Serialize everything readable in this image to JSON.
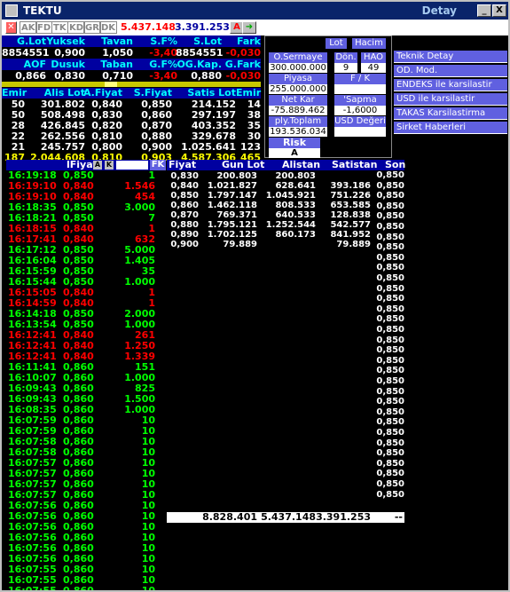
{
  "window": {
    "title": "TEKTU",
    "right_title": "Detay",
    "min": "_",
    "max": "□",
    "close": "X"
  },
  "toolbar": {
    "tabs": [
      "AK",
      "FD",
      "TK",
      "KD",
      "GR",
      "DK"
    ],
    "price": "5.437.148",
    "value": "3.391.253",
    "a_label": "A"
  },
  "quote": {
    "labels1": [
      "G.Lot",
      "Yuksek",
      "Tavan",
      "S.F%",
      "S.Lot",
      "Fark"
    ],
    "values1": [
      "8854551",
      "0,900",
      "1,050",
      "-3,40",
      "8854551",
      "-0,030"
    ],
    "labels2": [
      "AOF",
      "Dusuk",
      "Taban",
      "G.F%",
      "OG.Kap.",
      "G.Fark"
    ],
    "values2": [
      "0,866",
      "0,830",
      "0,710",
      "-3,40",
      "0,880",
      "-0,030"
    ]
  },
  "depth": {
    "headers": [
      "Emir",
      "Alis Lot",
      "A.Fiyat",
      "S.Fiyat",
      "Satis Lot",
      "Emir"
    ],
    "rows": [
      [
        "50",
        "301.802",
        "0,840",
        "0,850",
        "214.152",
        "14"
      ],
      [
        "50",
        "508.498",
        "0,830",
        "0,860",
        "297.197",
        "38"
      ],
      [
        "28",
        "426.845",
        "0,820",
        "0,870",
        "403.352",
        "35"
      ],
      [
        "22",
        "262.556",
        "0,810",
        "0,880",
        "329.678",
        "30"
      ],
      [
        "21",
        "245.757",
        "0,800",
        "0,900",
        "1.025.641",
        "123"
      ]
    ],
    "total": [
      "187",
      "2.044.608",
      "0,810",
      "0,903",
      "4.587.306",
      "465"
    ]
  },
  "panel": {
    "lot": "Lot",
    "hacim": "Hacim",
    "osermaye_label": "O.Sermaye",
    "osermaye": "300.000.000",
    "don_label": "Dön.",
    "don": "9",
    "hao_label": "HAO",
    "hao": "49",
    "piyasa_label": "Piyasa Değeri",
    "piyasa": "255.000.000",
    "fk_label": "F / K",
    "fk": "",
    "netkar_label": "Net Kar",
    "netkar": "-75.889.462",
    "sapma_label": "'Sapma",
    "sapma": "-1,6000",
    "toplam_label": "ply.Toplam Lot",
    "toplam": "193.536.034",
    "usd_label": "USD Değeri",
    "usd": "",
    "risk_label": "Risk Kodu",
    "risk": "A"
  },
  "menu": [
    "Teknik Detay",
    "OD. Mod.",
    "ENDEKS ile karsilastir",
    "USD ile karsilastir",
    "TAKAS Karsilastirma",
    "Sirket Haberleri"
  ],
  "trades": {
    "headers": [
      "lFiyat",
      "A",
      "K",
      "FK"
    ],
    "rows": [
      [
        "16:19:18",
        "0,850",
        "1",
        "g"
      ],
      [
        "16:19:10",
        "0,840",
        "1.546",
        "r"
      ],
      [
        "16:19:10",
        "0,840",
        "454",
        "r"
      ],
      [
        "16:18:35",
        "0,850",
        "3.000",
        "g"
      ],
      [
        "16:18:21",
        "0,850",
        "7",
        "g"
      ],
      [
        "16:18:15",
        "0,840",
        "1",
        "r"
      ],
      [
        "16:17:41",
        "0,840",
        "632",
        "r"
      ],
      [
        "16:17:12",
        "0,850",
        "5.000",
        "g"
      ],
      [
        "16:16:04",
        "0,850",
        "1.405",
        "g"
      ],
      [
        "16:15:59",
        "0,850",
        "35",
        "g"
      ],
      [
        "16:15:44",
        "0,850",
        "1.000",
        "g"
      ],
      [
        "16:15:05",
        "0,840",
        "1",
        "r"
      ],
      [
        "16:14:59",
        "0,840",
        "1",
        "r"
      ],
      [
        "16:14:18",
        "0,850",
        "2.000",
        "g"
      ],
      [
        "16:13:54",
        "0,850",
        "1.000",
        "g"
      ],
      [
        "16:12:41",
        "0,840",
        "261",
        "r"
      ],
      [
        "16:12:41",
        "0,840",
        "1.250",
        "r"
      ],
      [
        "16:12:41",
        "0,840",
        "1.339",
        "r"
      ],
      [
        "16:11:41",
        "0,860",
        "151",
        "g"
      ],
      [
        "16:10:07",
        "0,860",
        "1.000",
        "g"
      ],
      [
        "16:09:43",
        "0,860",
        "825",
        "g"
      ],
      [
        "16:09:43",
        "0,860",
        "1.500",
        "g"
      ],
      [
        "16:08:35",
        "0,860",
        "1.000",
        "g"
      ],
      [
        "16:07:59",
        "0,860",
        "10",
        "g"
      ],
      [
        "16:07:59",
        "0,860",
        "10",
        "g"
      ],
      [
        "16:07:58",
        "0,860",
        "10",
        "g"
      ],
      [
        "16:07:58",
        "0,860",
        "10",
        "g"
      ],
      [
        "16:07:57",
        "0,860",
        "10",
        "g"
      ],
      [
        "16:07:57",
        "0,860",
        "10",
        "g"
      ],
      [
        "16:07:57",
        "0,860",
        "10",
        "g"
      ],
      [
        "16:07:57",
        "0,860",
        "10",
        "g"
      ],
      [
        "16:07:56",
        "0,860",
        "10",
        "g"
      ],
      [
        "16:07:56",
        "0,860",
        "10",
        "g"
      ],
      [
        "16:07:56",
        "0,860",
        "10",
        "g"
      ],
      [
        "16:07:56",
        "0,860",
        "10",
        "g"
      ],
      [
        "16:07:56",
        "0,860",
        "10",
        "g"
      ],
      [
        "16:07:56",
        "0,860",
        "10",
        "g"
      ],
      [
        "16:07:55",
        "0,860",
        "10",
        "g"
      ],
      [
        "16:07:55",
        "0,860",
        "10",
        "g"
      ],
      [
        "16:07:55",
        "0,860",
        "10",
        "g"
      ]
    ]
  },
  "price_table": {
    "headers": [
      "Fiyat",
      "Gun Lot",
      "Alistan",
      "Satistan",
      "Son"
    ],
    "rows": [
      [
        "0,830",
        "200.803",
        "200.803",
        ""
      ],
      [
        "0,840",
        "1.021.827",
        "628.641",
        "393.186"
      ],
      [
        "0,850",
        "1.797.147",
        "1.045.921",
        "751.226"
      ],
      [
        "0,860",
        "1.462.118",
        "808.533",
        "653.585"
      ],
      [
        "0,870",
        "769.371",
        "640.533",
        "128.838"
      ],
      [
        "0,880",
        "1.795.121",
        "1.252.544",
        "542.577"
      ],
      [
        "0,890",
        "1.702.125",
        "860.173",
        "841.952"
      ],
      [
        "0,900",
        "79.889",
        "",
        "79.889"
      ]
    ],
    "son_value": "0,850",
    "son_count": 32,
    "totals": [
      "8.828.401",
      "5.437.148",
      "3.391.253",
      "--"
    ]
  }
}
